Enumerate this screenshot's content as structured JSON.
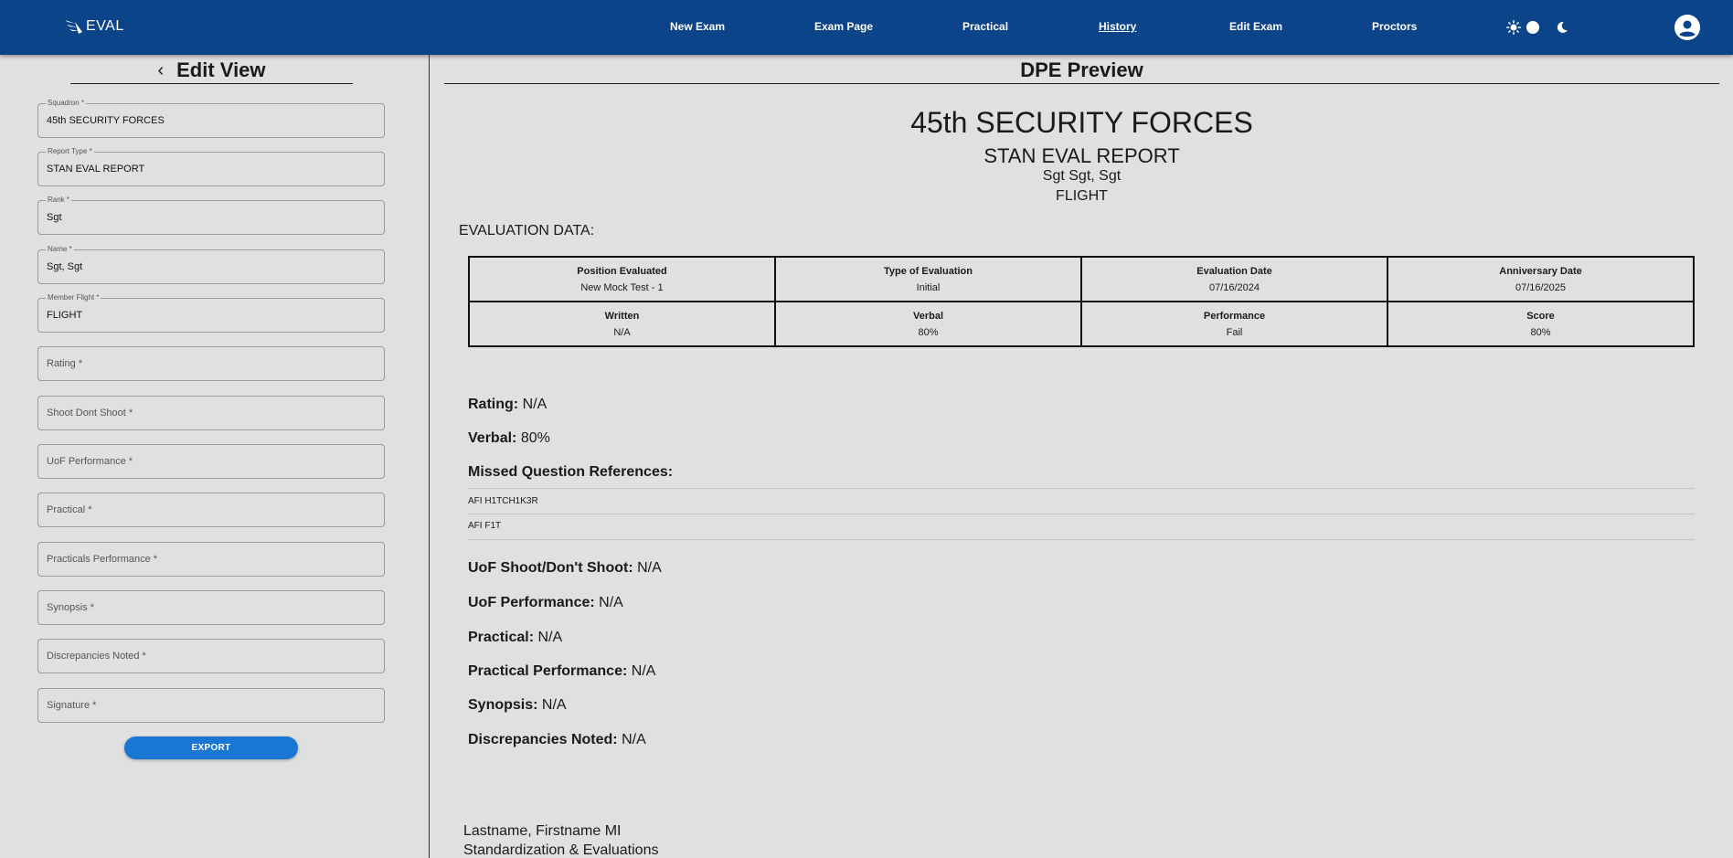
{
  "app": {
    "logo_text": "EVAL"
  },
  "nav": {
    "items": [
      {
        "label": "New Exam"
      },
      {
        "label": "Exam Page"
      },
      {
        "label": "Practical"
      },
      {
        "label": "History"
      },
      {
        "label": "Edit Exam"
      },
      {
        "label": "Proctors"
      }
    ],
    "active": "History"
  },
  "edit_view": {
    "title": "Edit View",
    "fields": [
      {
        "label": "Squadron *",
        "value": "45th SECURITY FORCES"
      },
      {
        "label": "Report Type *",
        "value": "STAN EVAL REPORT"
      },
      {
        "label": "Rank *",
        "value": "Sgt"
      },
      {
        "label": "Name *",
        "value": "Sgt, Sgt"
      },
      {
        "label": "Member Flight *",
        "value": "FLIGHT"
      },
      {
        "placeholder": "Rating *"
      },
      {
        "placeholder": "Shoot Dont Shoot *"
      },
      {
        "placeholder": "UoF Performance *"
      },
      {
        "placeholder": "Practical *"
      },
      {
        "placeholder": "Practicals Performance *"
      },
      {
        "placeholder": "Synopsis *"
      },
      {
        "placeholder": "Discrepancies Noted *"
      },
      {
        "placeholder": "Signature *"
      }
    ],
    "export_label": "EXPORT"
  },
  "preview": {
    "title": "DPE Preview",
    "squadron": "45th SECURITY FORCES",
    "report_type": "STAN EVAL REPORT",
    "name": "Sgt Sgt, Sgt",
    "flight": "FLIGHT",
    "eval_data_label": "EVALUATION DATA:",
    "table": [
      [
        {
          "header": "Position Evaluated",
          "value": "New Mock Test - 1"
        },
        {
          "header": "Type of Evaluation",
          "value": "Initial"
        },
        {
          "header": "Evaluation Date",
          "value": "07/16/2024"
        },
        {
          "header": "Anniversary Date",
          "value": "07/16/2025"
        }
      ],
      [
        {
          "header": "Written",
          "value": "N/A"
        },
        {
          "header": "Verbal",
          "value": "80%"
        },
        {
          "header": "Performance",
          "value": "Fail"
        },
        {
          "header": "Score",
          "value": "80%"
        }
      ]
    ],
    "rating": {
      "label": "Rating:",
      "value": "N/A"
    },
    "verbal": {
      "label": "Verbal:",
      "value": "80%"
    },
    "missed_title": "Missed Question References:",
    "missed_refs": [
      "AFI H1TCH1K3R",
      "AFI F1T"
    ],
    "details": [
      {
        "label": "UoF Shoot/Don't Shoot:",
        "value": "N/A"
      },
      {
        "label": "UoF Performance:",
        "value": "N/A"
      },
      {
        "label": "Practical:",
        "value": "N/A"
      },
      {
        "label": "Practical Performance:",
        "value": "N/A"
      },
      {
        "label": "Synopsis:",
        "value": "N/A"
      },
      {
        "label": "Discrepancies Noted:",
        "value": "N/A"
      }
    ],
    "signature_name": "Lastname, Firstname MI",
    "signature_office": "Standardization & Evaluations"
  },
  "colors": {
    "nav_bg": "#0c4489",
    "accent": "#1976d2",
    "page_bg": "#e0e0e0"
  },
  "icons": [
    "logo-wing-icon",
    "sun-icon",
    "moon-icon",
    "account-circle-icon",
    "chevron-left-icon"
  ]
}
